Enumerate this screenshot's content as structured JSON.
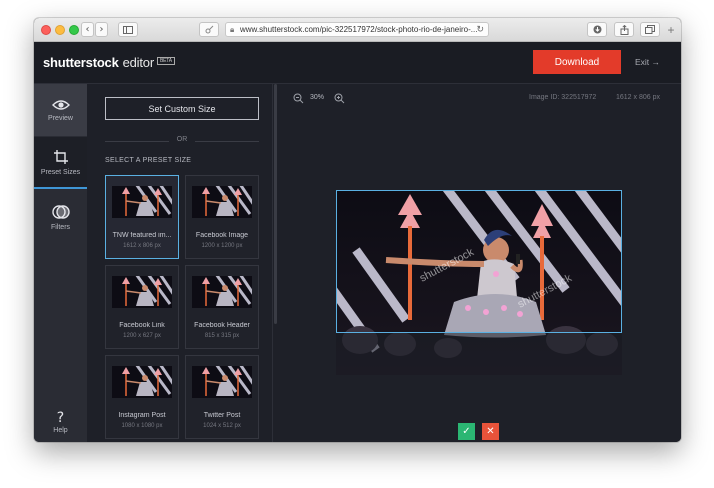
{
  "browser": {
    "url": "www.shutterstock.com/pic-322517972/stock-photo-rio-de-janeiro-...",
    "nav_back": "‹",
    "nav_forward": "›",
    "sidebar_icon": "sidebar-icon",
    "download_icon": "download-icon",
    "share_icon": "share-icon",
    "tabs_icon": "tabs-icon",
    "new_tab": "+"
  },
  "header": {
    "logo": "shutterstock",
    "product": "editor",
    "beta": "BETA",
    "download_label": "Download",
    "exit_label": "Exit →"
  },
  "rail": {
    "preview": "Preview",
    "preset_sizes": "Preset Sizes",
    "filters": "Filters",
    "help": "Help",
    "help_glyph": "?"
  },
  "panel": {
    "custom_label": "Set Custom Size",
    "or": "OR",
    "heading": "SELECT A PRESET SIZE",
    "presets": [
      {
        "name": "TNW featured im...",
        "size": "1612 x 806 px",
        "selected": true
      },
      {
        "name": "Facebook Image",
        "size": "1200 x 1200 px"
      },
      {
        "name": "Facebook Link",
        "size": "1200 x 627 px"
      },
      {
        "name": "Facebook Header",
        "size": "815 x 315 px"
      },
      {
        "name": "Instagram Post",
        "size": "1080 x 1080 px"
      },
      {
        "name": "Twitter Post",
        "size": "1024 x 512 px"
      }
    ]
  },
  "workspace": {
    "zoom": "30%",
    "image_id": "Image ID: 322517972",
    "dimensions": "1612 x 806 px",
    "watermark": "shutterstock",
    "confirm": "✓",
    "cancel": "✕"
  },
  "colors": {
    "accent": "#e33b2a",
    "selection": "#5ab0e2",
    "confirm": "#2bb673",
    "cancel": "#e8533a"
  }
}
